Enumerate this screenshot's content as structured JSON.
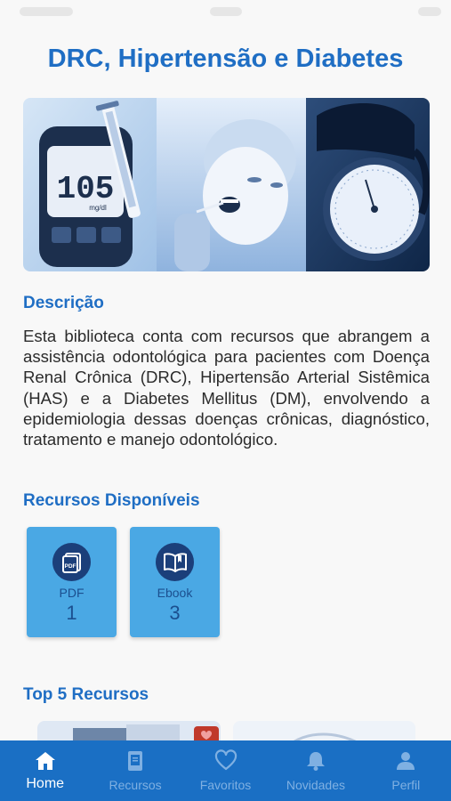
{
  "page": {
    "title": "DRC, Hipertensão e Diabetes"
  },
  "hero": {
    "meter_reading": "105",
    "meter_unit": "mg/dl"
  },
  "description": {
    "heading": "Descrição",
    "text": "Esta biblioteca conta com recursos que abrangem a assistência odontológica para pacientes com Doença Renal Crônica (DRC), Hipertensão Arterial Sistêmica (HAS) e a Diabetes Mellitus (DM), envolvendo a epidemiologia dessas doenças crônicas, diagnóstico, tratamento e manejo odontológico."
  },
  "resources": {
    "heading": "Recursos Disponíveis",
    "items": [
      {
        "label": "PDF",
        "count": "1",
        "icon": "pdf-icon",
        "icon_text": "PDF"
      },
      {
        "label": "Ebook",
        "count": "3",
        "icon": "open-book-icon"
      }
    ]
  },
  "top5": {
    "heading": "Top 5 Recursos"
  },
  "tabbar": {
    "active": "Home",
    "items": [
      {
        "label": "Home",
        "icon": "home-icon"
      },
      {
        "label": "Recursos",
        "icon": "tablet-icon"
      },
      {
        "label": "Favoritos",
        "icon": "heart-icon"
      },
      {
        "label": "Novidades",
        "icon": "bell-icon"
      },
      {
        "label": "Perfil",
        "icon": "person-icon"
      }
    ]
  },
  "colors": {
    "accent": "#1f6ec4",
    "card": "#4aa8e4",
    "icon_circle": "#1b3f7a",
    "tabbar": "#1a6fc4"
  }
}
